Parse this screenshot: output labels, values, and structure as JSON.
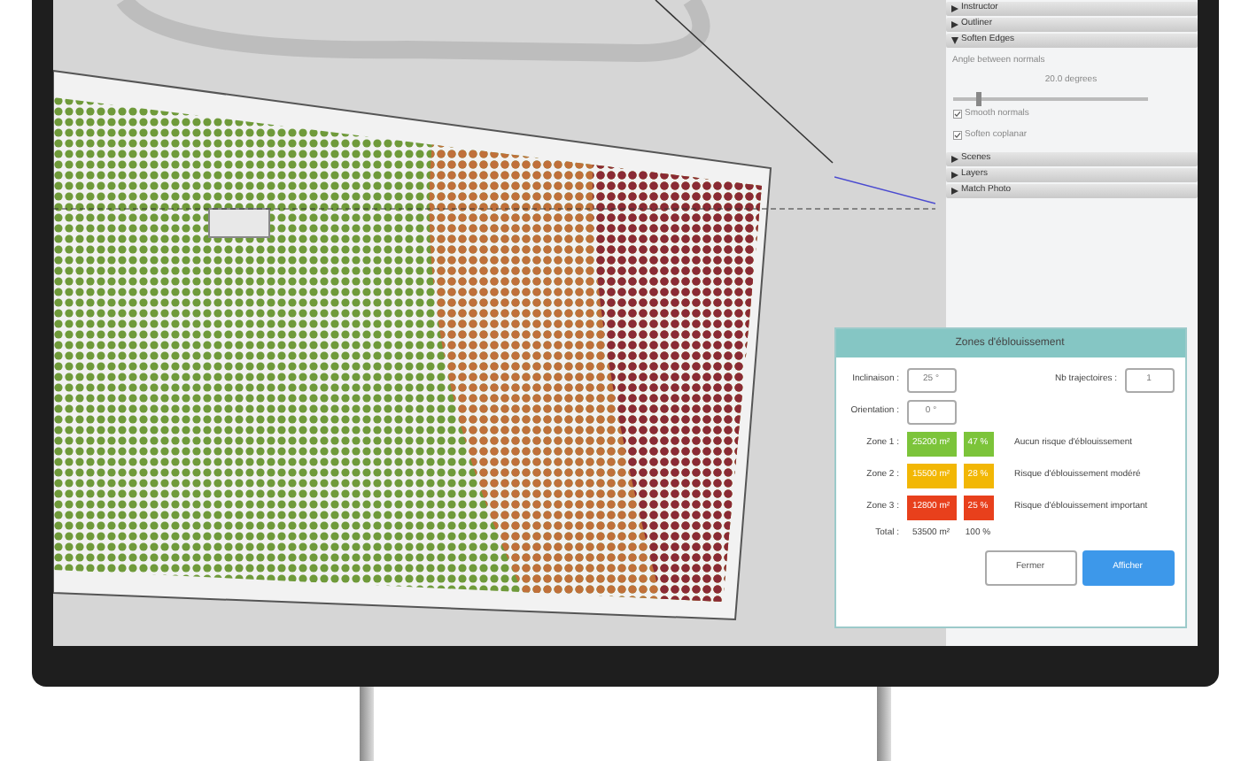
{
  "side_panel": {
    "sections": [
      {
        "label": "Instructor",
        "expanded": false
      },
      {
        "label": "Outliner",
        "expanded": false
      },
      {
        "label": "Soften Edges",
        "expanded": true
      },
      {
        "label": "Scenes",
        "expanded": false
      },
      {
        "label": "Layers",
        "expanded": false
      },
      {
        "label": "Match Photo",
        "expanded": false
      }
    ],
    "soften_edges": {
      "angle_label": "Angle between normals",
      "angle_value": "20.0 degrees",
      "level": 0.12,
      "options": [
        {
          "label": "Smooth normals",
          "checked": true
        },
        {
          "label": "Soften coplanar",
          "checked": true
        }
      ]
    }
  },
  "dialog": {
    "title": "Zones d'éblouissement",
    "inclinaison": {
      "label": "Inclinaison :",
      "value": "25 °"
    },
    "trajectoires": {
      "label": "Nb trajectoires :",
      "value": "1"
    },
    "orientation": {
      "label": "Orientation :",
      "value": "0 °"
    },
    "zones": [
      {
        "label": "Zone 1 :",
        "area": "25200 m²",
        "share": "47 %",
        "description": "Aucun risque d'éblouissement",
        "color": "#7cc43a"
      },
      {
        "label": "Zone 2 :",
        "area": "15500 m²",
        "share": "28 %",
        "description": "Risque d'éblouissement modéré",
        "color": "#f2b705"
      },
      {
        "label": "Zone 3 :",
        "area": "12800 m²",
        "share": "25 %",
        "description": "Risque d'éblouissement important",
        "color": "#e8401c"
      }
    ],
    "total": {
      "label": "Total :",
      "area": "53500 m²",
      "share": "100 %"
    },
    "buttons": [
      {
        "label": "Fermer",
        "kind": "secondary"
      },
      {
        "label": "Afficher",
        "kind": "primary"
      }
    ]
  }
}
